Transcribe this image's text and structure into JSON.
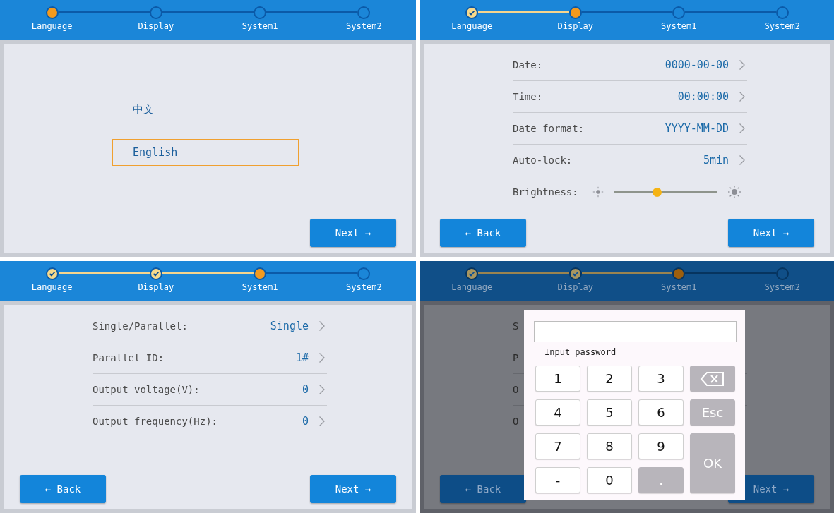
{
  "screens": [
    {
      "kind": "language",
      "dimmed": false,
      "steps": [
        {
          "label": "Language",
          "done": false,
          "current": true
        },
        {
          "label": "Display",
          "done": false,
          "current": false
        },
        {
          "label": "System1",
          "done": false,
          "current": false
        },
        {
          "label": "System2",
          "done": false,
          "current": false
        }
      ],
      "options": [
        {
          "label": "中文",
          "selected": false
        },
        {
          "label": "English",
          "selected": true
        }
      ],
      "buttons": [
        {
          "kind": "next",
          "label": "Next →"
        }
      ]
    },
    {
      "kind": "settings",
      "dimmed": false,
      "steps": [
        {
          "label": "Language",
          "done": true,
          "current": false
        },
        {
          "label": "Display",
          "done": false,
          "current": true
        },
        {
          "label": "System1",
          "done": false,
          "current": false
        },
        {
          "label": "System2",
          "done": false,
          "current": false
        }
      ],
      "rows": [
        {
          "kind": "setting",
          "label": "Date:",
          "value": "0000-00-00"
        },
        {
          "kind": "setting",
          "label": "Time:",
          "value": "00:00:00"
        },
        {
          "kind": "setting",
          "label": "Date format:",
          "value": "YYYY-MM-DD"
        },
        {
          "kind": "setting",
          "label": "Auto-lock:",
          "value": "5min"
        },
        {
          "kind": "slider",
          "label": "Brightness:",
          "level": 0.42
        }
      ],
      "buttons": [
        {
          "kind": "back",
          "label": "← Back"
        },
        {
          "kind": "next",
          "label": "Next →"
        }
      ]
    },
    {
      "kind": "settings",
      "dimmed": false,
      "steps": [
        {
          "label": "Language",
          "done": true,
          "current": false
        },
        {
          "label": "Display",
          "done": true,
          "current": false
        },
        {
          "label": "System1",
          "done": false,
          "current": true
        },
        {
          "label": "System2",
          "done": false,
          "current": false
        }
      ],
      "rows": [
        {
          "kind": "setting",
          "label": "Single/Parallel:",
          "value": "Single"
        },
        {
          "kind": "setting",
          "label": "Parallel ID:",
          "value": "1#"
        },
        {
          "kind": "setting",
          "label": "Output voltage(V):",
          "value": "0"
        },
        {
          "kind": "setting",
          "label": "Output frequency(Hz):",
          "value": "0"
        }
      ],
      "buttons": [
        {
          "kind": "back",
          "label": "← Back"
        },
        {
          "kind": "next",
          "label": "Next →"
        }
      ]
    },
    {
      "kind": "settings",
      "dimmed": true,
      "steps": [
        {
          "label": "Language",
          "done": true,
          "current": false
        },
        {
          "label": "Display",
          "done": true,
          "current": false
        },
        {
          "label": "System1",
          "done": false,
          "current": true
        },
        {
          "label": "System2",
          "done": false,
          "current": false
        }
      ],
      "rows": [
        {
          "kind": "label",
          "label": "S"
        },
        {
          "kind": "label",
          "label": "P"
        },
        {
          "kind": "label",
          "label": "O"
        },
        {
          "kind": "label",
          "label": "O"
        }
      ],
      "buttons": [
        {
          "kind": "back",
          "label": "← Back"
        },
        {
          "kind": "next",
          "label": "Next →"
        }
      ],
      "dialog": {
        "label": "Input password",
        "keys": [
          {
            "kind": "digit",
            "label": "1"
          },
          {
            "kind": "digit",
            "label": "2"
          },
          {
            "kind": "digit",
            "label": "3"
          },
          {
            "kind": "backspace"
          },
          {
            "kind": "digit",
            "label": "4"
          },
          {
            "kind": "digit",
            "label": "5"
          },
          {
            "kind": "digit",
            "label": "6"
          },
          {
            "kind": "esc",
            "label": "Esc"
          },
          {
            "kind": "digit",
            "label": "7"
          },
          {
            "kind": "digit",
            "label": "8"
          },
          {
            "kind": "digit",
            "label": "9"
          },
          {
            "kind": "ok",
            "label": "OK"
          },
          {
            "kind": "digit",
            "label": "-"
          },
          {
            "kind": "digit",
            "label": "0"
          },
          {
            "kind": "dot",
            "label": "."
          }
        ]
      }
    }
  ]
}
